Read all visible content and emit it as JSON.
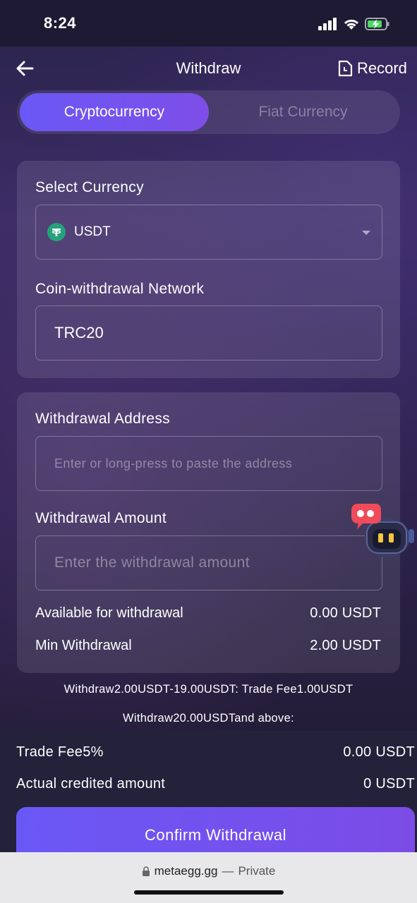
{
  "status_bar": {
    "time": "8:24"
  },
  "header": {
    "title": "Withdraw",
    "record_label": "Record"
  },
  "tabs": [
    {
      "label": "Cryptocurrency",
      "active": true
    },
    {
      "label": "Fiat Currency",
      "active": false
    }
  ],
  "currency_section": {
    "select_label": "Select Currency",
    "selected_currency": "USDT",
    "network_label": "Coin-withdrawal Network",
    "network_value": "TRC20"
  },
  "withdraw_section": {
    "address_label": "Withdrawal Address",
    "address_placeholder": "Enter or long-press to paste the address",
    "amount_label": "Withdrawal Amount",
    "amount_placeholder": "Enter the withdrawal amount",
    "available_label": "Available for withdrawal",
    "available_value": "0.00 USDT",
    "min_label": "Min Withdrawal",
    "min_value": "2.00 USDT"
  },
  "notices": [
    "Withdraw2.00USDT-19.00USDT: Trade Fee1.00USDT",
    "Withdraw20.00USDTand above:"
  ],
  "summary": {
    "fee_label": "Trade Fee5%",
    "fee_value": "0.00 USDT",
    "credited_label": "Actual credited amount",
    "credited_value": "0 USDT"
  },
  "confirm_label": "Confirm Withdrawal",
  "browser": {
    "domain": "metaegg.gg",
    "separator": "—",
    "mode": "Private"
  },
  "colors": {
    "accent": "#6a58f6",
    "accent_end": "#7e4ee8",
    "usdt_green": "#26a17b"
  }
}
